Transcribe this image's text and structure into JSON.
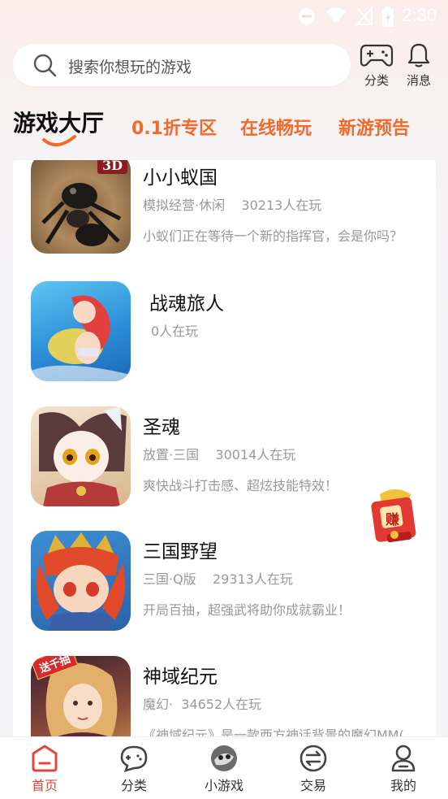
{
  "status_bar": {
    "time": "2:30"
  },
  "search": {
    "placeholder": "搜索你想玩的游戏"
  },
  "top_actions": [
    {
      "label": "分类",
      "icon": "gamepad-icon"
    },
    {
      "label": "消息",
      "icon": "bell-icon"
    }
  ],
  "tabs": [
    {
      "label": "游戏大厅",
      "active": true
    },
    {
      "label": "0.1折专区",
      "active": false
    },
    {
      "label": "在线畅玩",
      "active": false
    },
    {
      "label": "新游预告",
      "active": false
    }
  ],
  "games": [
    {
      "title": "小小蚁国",
      "badge": "3D",
      "meta": "模拟经营·休闲    30213人在玩",
      "desc": "小蚁们正在等待一个新的指挥官，会是你吗？"
    },
    {
      "title": "战魂旅人",
      "meta": "0人在玩",
      "desc": ""
    },
    {
      "title": "圣魂",
      "meta": "放置·三国    30014人在玩",
      "desc": "爽快战斗打击感、超炫技能特效！"
    },
    {
      "title": "三国野望",
      "meta": "三国·Q版    29313人在玩",
      "desc": "开局百抽，超强武将助你成就霸业！"
    },
    {
      "title": "神域纪元",
      "badge": "送千抽",
      "meta": "魔幻·  34652人在玩",
      "desc": "《神域纪元》是一款西方神话背景的魔幻MM("
    }
  ],
  "floating": {
    "label": "赚"
  },
  "bottom_nav": [
    {
      "label": "首页",
      "icon": "home-icon",
      "active": true
    },
    {
      "label": "分类",
      "icon": "category-chat-icon",
      "active": false
    },
    {
      "label": "小游戏",
      "icon": "mini-game-icon",
      "active": false
    },
    {
      "label": "交易",
      "icon": "trade-icon",
      "active": false
    },
    {
      "label": "我的",
      "icon": "profile-icon",
      "active": false
    }
  ],
  "colors": {
    "accent": "#f26a2b",
    "nav_active": "#e4463c"
  }
}
